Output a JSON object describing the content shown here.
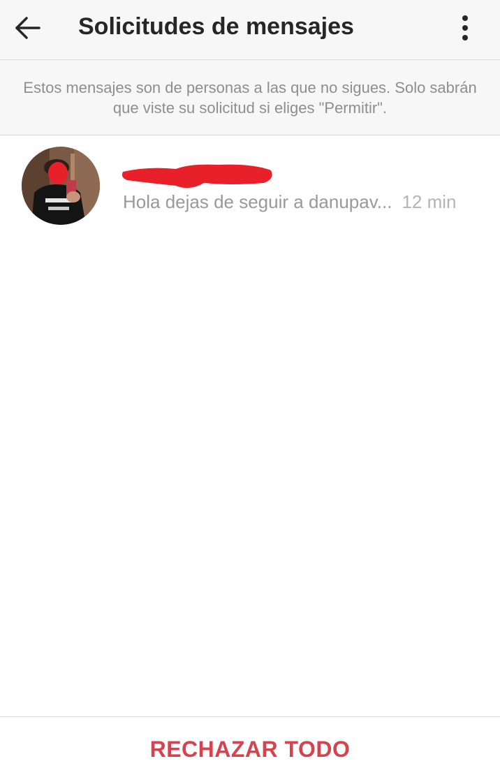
{
  "header": {
    "title": "Solicitudes de mensajes",
    "back_icon": "arrow-left-icon",
    "menu_icon": "more-vertical-icon"
  },
  "info": {
    "text": "Estos mensajes son de personas a las que no sigues. Solo sabrán que viste su solicitud si eliges \"Permitir\"."
  },
  "requests": [
    {
      "preview": "Hola dejas de seguir a danupav...",
      "time": "12 min"
    }
  ],
  "footer": {
    "reject_all_label": "RECHAZAR TODO"
  },
  "colors": {
    "accent": "#d5444e",
    "redaction": "#e8202a",
    "header_bg": "#f7f7f7",
    "secondary_text": "#8e8e8e"
  }
}
